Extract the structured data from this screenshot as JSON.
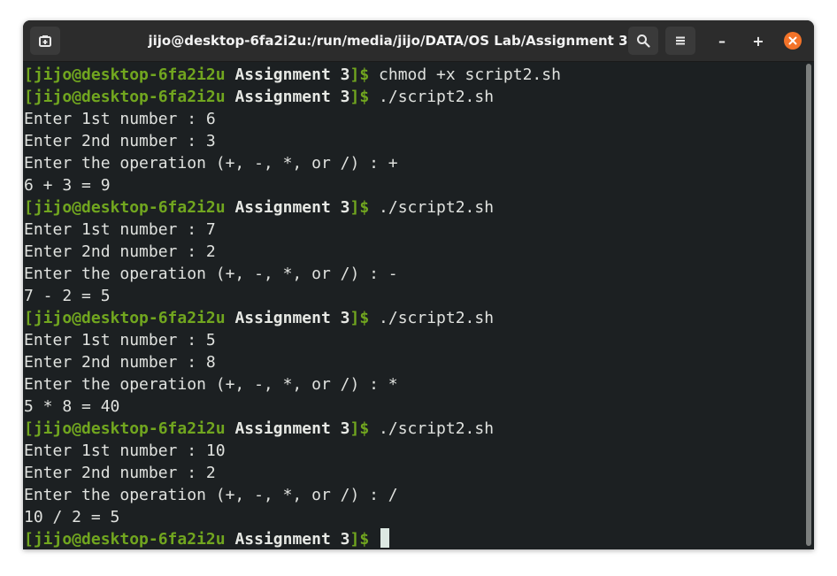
{
  "window": {
    "title": "jijo@desktop-6fa2i2u:/run/media/jijo/DATA/OS Lab/Assignment 3"
  },
  "toolbar": {
    "new_tab_icon": "new-tab-icon",
    "search_icon": "search-icon",
    "menu_icon": "hamburger-menu-icon",
    "minimize_glyph": "–",
    "maximize_glyph": "+",
    "close_glyph": "×"
  },
  "colors": {
    "prompt_green": "#71a61f",
    "terminal_bg": "#1c2022",
    "text": "#e0e2df",
    "close_orange": "#f37329"
  },
  "terminal": {
    "prompt": {
      "open": "[",
      "user_host": "jijo@desktop-6fa2i2u",
      "dir": "Assignment 3",
      "close": "]$"
    },
    "lines": [
      {
        "type": "prompt",
        "cmd": "chmod +x script2.sh"
      },
      {
        "type": "prompt",
        "cmd": "./script2.sh"
      },
      {
        "type": "output",
        "text": "Enter 1st number : 6"
      },
      {
        "type": "output",
        "text": "Enter 2nd number : 3"
      },
      {
        "type": "output",
        "text": "Enter the operation (+, -, *, or /) : +"
      },
      {
        "type": "output",
        "text": "6 + 3 = 9"
      },
      {
        "type": "prompt",
        "cmd": "./script2.sh"
      },
      {
        "type": "output",
        "text": "Enter 1st number : 7"
      },
      {
        "type": "output",
        "text": "Enter 2nd number : 2"
      },
      {
        "type": "output",
        "text": "Enter the operation (+, -, *, or /) : -"
      },
      {
        "type": "output",
        "text": "7 - 2 = 5"
      },
      {
        "type": "prompt",
        "cmd": "./script2.sh"
      },
      {
        "type": "output",
        "text": "Enter 1st number : 5"
      },
      {
        "type": "output",
        "text": "Enter 2nd number : 8"
      },
      {
        "type": "output",
        "text": "Enter the operation (+, -, *, or /) : *"
      },
      {
        "type": "output",
        "text": "5 * 8 = 40"
      },
      {
        "type": "prompt",
        "cmd": "./script2.sh"
      },
      {
        "type": "output",
        "text": "Enter 1st number : 10"
      },
      {
        "type": "output",
        "text": "Enter 2nd number : 2"
      },
      {
        "type": "output",
        "text": "Enter the operation (+, -, *, or /) : /"
      },
      {
        "type": "output",
        "text": "10 / 2 = 5"
      },
      {
        "type": "prompt",
        "cmd": "",
        "cursor": true
      }
    ]
  }
}
